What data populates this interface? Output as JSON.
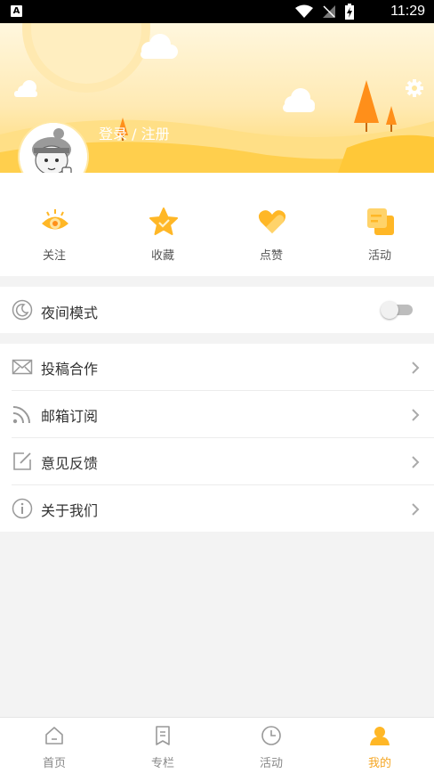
{
  "status_bar": {
    "time": "11:29",
    "notification_icon": "A"
  },
  "profile": {
    "login_text": "登录 / 注册"
  },
  "quick_actions": [
    {
      "label": "关注",
      "icon": "eye-icon"
    },
    {
      "label": "收藏",
      "icon": "star-icon"
    },
    {
      "label": "点赞",
      "icon": "heart-icon"
    },
    {
      "label": "活动",
      "icon": "activity-icon"
    }
  ],
  "night_mode": {
    "label": "夜间模式",
    "enabled": false
  },
  "menu": [
    {
      "label": "投稿合作",
      "icon": "envelope-icon"
    },
    {
      "label": "邮箱订阅",
      "icon": "rss-icon"
    },
    {
      "label": "意见反馈",
      "icon": "edit-icon"
    },
    {
      "label": "关于我们",
      "icon": "info-icon"
    }
  ],
  "tabs": [
    {
      "label": "首页",
      "icon": "home-icon",
      "active": false
    },
    {
      "label": "专栏",
      "icon": "bookmark-icon",
      "active": false
    },
    {
      "label": "活动",
      "icon": "clock-icon",
      "active": false
    },
    {
      "label": "我的",
      "icon": "user-icon",
      "active": true
    }
  ],
  "colors": {
    "accent": "#f5a623",
    "icon_orange": "#ffb726",
    "header_light": "#fff7de",
    "header_dark": "#ffd86c"
  }
}
